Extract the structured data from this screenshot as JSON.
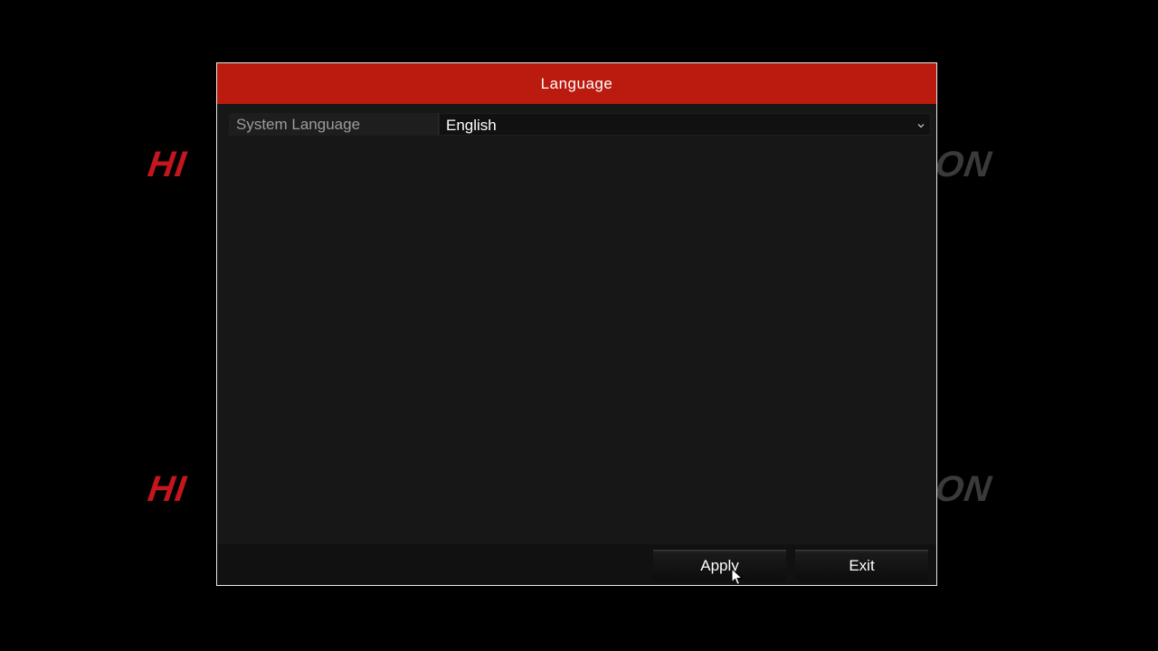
{
  "background": {
    "logo_left": "HI",
    "logo_right": "ON"
  },
  "dialog": {
    "title": "Language",
    "settings": [
      {
        "label": "System Language",
        "value": "English"
      }
    ],
    "buttons": {
      "apply_label": "Apply",
      "exit_label": "Exit"
    }
  },
  "colors": {
    "header": "#bb1a0e",
    "brand_red": "#c4161c",
    "background": "#000000"
  },
  "icons": {
    "dropdown": "chevron-down-icon",
    "cursor": "mouse-pointer-icon"
  }
}
